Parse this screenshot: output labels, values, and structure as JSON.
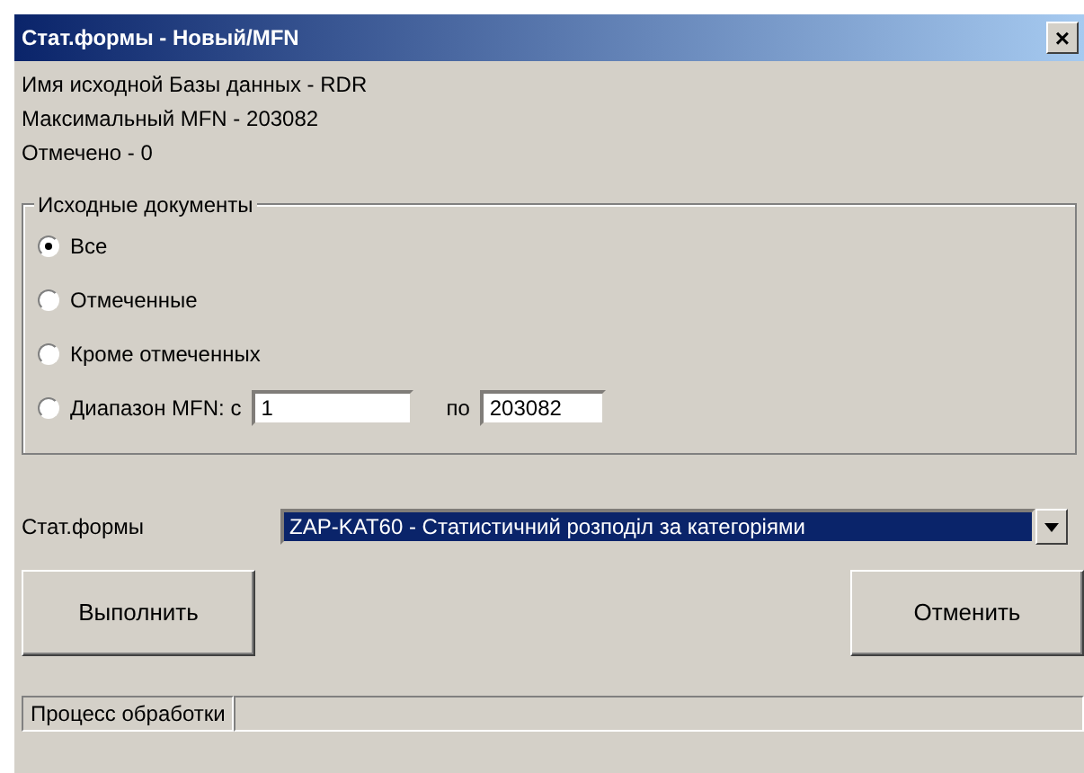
{
  "window": {
    "title": "Стат.формы - Новый/MFN",
    "close": "×"
  },
  "info": [
    "Имя исходной Базы данных - RDR",
    "Максимальный MFN  - 203082",
    "Отмечено - 0"
  ],
  "group": {
    "title": "Исходные документы",
    "options": [
      {
        "label": "Все",
        "selected": true
      },
      {
        "label": "Отмеченные",
        "selected": false
      },
      {
        "label": "Кроме отмеченных",
        "selected": false
      },
      {
        "label": "Диапазон MFN: с",
        "selected": false
      }
    ],
    "range_from": "1",
    "range_to_label": "по",
    "range_to": "203082"
  },
  "form": {
    "label": "Стат.формы",
    "value": "ZAP-KAT60 - Статистичний розподіл за категоріями"
  },
  "buttons": [
    {
      "label": "Выполнить"
    },
    {
      "label": "Отменить"
    }
  ],
  "status_bar": {
    "label": "Процесс обработки"
  }
}
